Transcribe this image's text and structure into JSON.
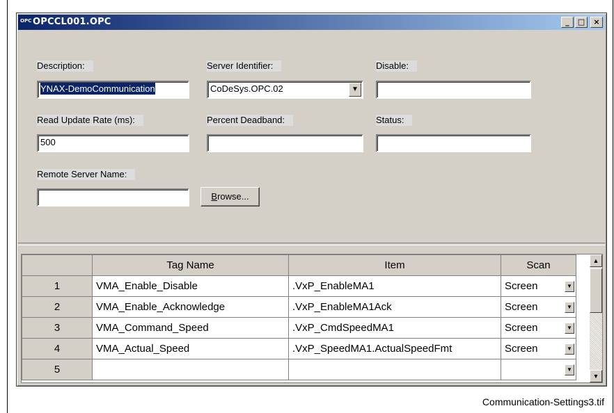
{
  "window": {
    "icon_text": "OPC",
    "title": "OPCCL001.OPC",
    "minimize": "_",
    "maximize": "□",
    "close": "×"
  },
  "form": {
    "description_label": "Description:",
    "description_value": "YNAX-DemoCommunication",
    "server_identifier_label": "Server Identifier:",
    "server_identifier_value": "CoDeSys.OPC.02",
    "disable_label": "Disable:",
    "disable_value": "",
    "read_update_rate_label": "Read Update Rate (ms):",
    "read_update_rate_value": "500",
    "percent_deadband_label": "Percent Deadband:",
    "percent_deadband_value": "",
    "status_label": "Status:",
    "status_value": "",
    "remote_server_label": "Remote Server Name:",
    "remote_server_value": "",
    "browse_prefix": "B",
    "browse_rest": "rowse..."
  },
  "grid": {
    "columns": [
      "",
      "Tag Name",
      "Item",
      "Scan"
    ],
    "rows": [
      {
        "num": "1",
        "tag": "VMA_Enable_Disable",
        "item": ".VxP_EnableMA1",
        "scan": "Screen"
      },
      {
        "num": "2",
        "tag": "VMA_Enable_Acknowledge",
        "item": ".VxP_EnableMA1Ack",
        "scan": "Screen"
      },
      {
        "num": "3",
        "tag": "VMA_Command_Speed",
        "item": ".VxP_CmdSpeedMA1",
        "scan": "Screen"
      },
      {
        "num": "4",
        "tag": "VMA_Actual_Speed",
        "item": ".VxP_SpeedMA1.ActualSpeedFmt",
        "scan": "Screen"
      },
      {
        "num": "5",
        "tag": "",
        "item": "",
        "scan": ""
      }
    ]
  },
  "caption": "Communication-Settings3.tif"
}
